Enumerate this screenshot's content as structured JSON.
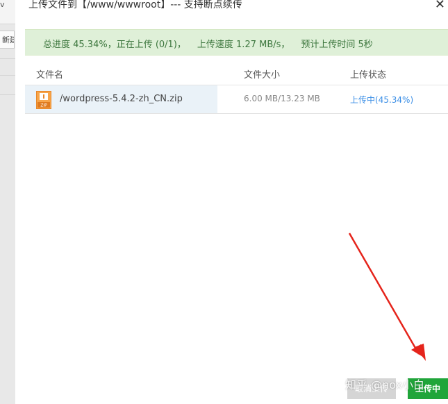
{
  "background": {
    "top_label": "v",
    "button_label": "新建"
  },
  "dialog": {
    "title": "上传文件到【/www/wwwroot】--- 支持断点续传",
    "close_symbol": "✕"
  },
  "progress": {
    "total": "总进度 45.34%，正在上传 (0/1)，",
    "speed": "上传速度 1.27 MB/s，",
    "eta": "预计上传时间 5秒"
  },
  "table": {
    "headers": {
      "name": "文件名",
      "size": "文件大小",
      "status": "上传状态"
    },
    "rows": [
      {
        "name": "/wordpress-5.4.2-zh_CN.zip",
        "size": "6.00 MB/13.23 MB",
        "status": "上传中(45.34%)",
        "icon": "zip-file-icon",
        "icon_text": "ZIP"
      }
    ]
  },
  "buttons": {
    "cancel": "取消上传",
    "upload": "上传中"
  },
  "watermark": "知乎 @nox小白",
  "colors": {
    "accent_green": "#20a53a",
    "status_blue": "#3a8ee6",
    "progress_bg": "#dff0d8",
    "annotation_red": "#e5241b"
  }
}
